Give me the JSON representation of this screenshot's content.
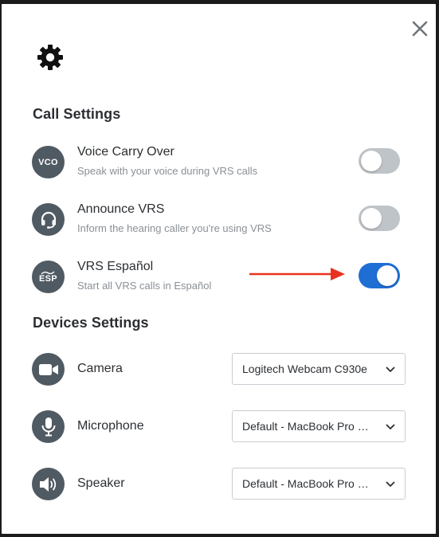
{
  "close_icon": "close-icon",
  "header_icon": "gear-icon",
  "call_settings": {
    "title": "Call Settings",
    "items": [
      {
        "icon_text": "VCO",
        "title": "Voice Carry Over",
        "desc": "Speak with your voice during VRS calls",
        "enabled": false
      },
      {
        "icon": "headset-icon",
        "title": "Announce VRS",
        "desc": "Inform the hearing caller you're using VRS",
        "enabled": false
      },
      {
        "icon_text": "ESP",
        "title": "VRS Español",
        "desc": "Start all VRS calls in Español",
        "enabled": true
      }
    ]
  },
  "devices_settings": {
    "title": "Devices Settings",
    "items": [
      {
        "icon": "camera-icon",
        "label": "Camera",
        "value": "Logitech Webcam C930e"
      },
      {
        "icon": "microphone-icon",
        "label": "Microphone",
        "value": "Default - MacBook Pro Microphone"
      },
      {
        "icon": "speaker-icon",
        "label": "Speaker",
        "value": "Default - MacBook Pro Speakers"
      }
    ]
  },
  "colors": {
    "accent": "#1f6ed4",
    "icon_bg": "#505a63",
    "arrow": "#e8321e",
    "toggle_off": "#bfc4c8"
  }
}
